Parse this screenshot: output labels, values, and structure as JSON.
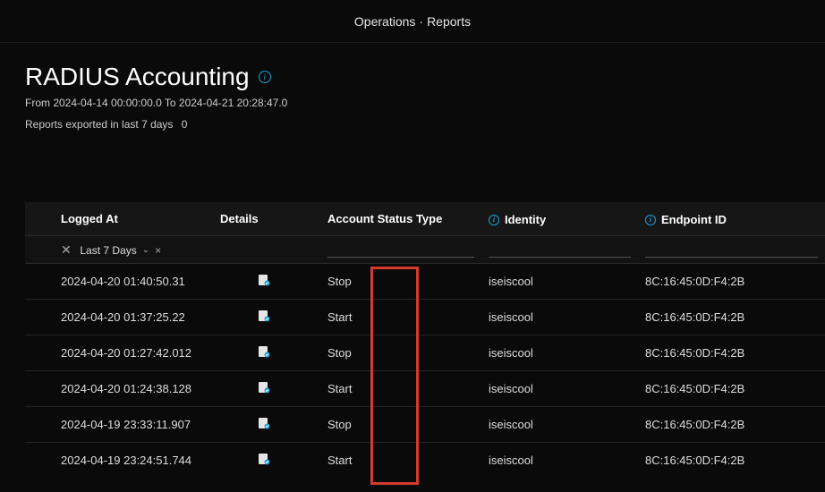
{
  "breadcrumb": {
    "part1": "Operations",
    "sep": "·",
    "part2": "Reports"
  },
  "page": {
    "title": "RADIUS Accounting",
    "date_range": "From 2024-04-14 00:00:00.0 To 2024-04-21 20:28:47.0",
    "exported_label": "Reports exported in last 7 days",
    "exported_count": "0"
  },
  "table": {
    "headers": {
      "logged_at": "Logged At",
      "details": "Details",
      "status": "Account Status Type",
      "identity": "Identity",
      "endpoint": "Endpoint ID"
    },
    "filter": {
      "range": "Last 7 Days"
    },
    "rows": [
      {
        "logged": "2024-04-20 01:40:50.31",
        "status": "Stop",
        "identity": "iseiscool",
        "endpoint": "8C:16:45:0D:F4:2B"
      },
      {
        "logged": "2024-04-20 01:37:25.22",
        "status": "Start",
        "identity": "iseiscool",
        "endpoint": "8C:16:45:0D:F4:2B"
      },
      {
        "logged": "2024-04-20 01:27:42.012",
        "status": "Stop",
        "identity": "iseiscool",
        "endpoint": "8C:16:45:0D:F4:2B"
      },
      {
        "logged": "2024-04-20 01:24:38.128",
        "status": "Start",
        "identity": "iseiscool",
        "endpoint": "8C:16:45:0D:F4:2B"
      },
      {
        "logged": "2024-04-19 23:33:11.907",
        "status": "Stop",
        "identity": "iseiscool",
        "endpoint": "8C:16:45:0D:F4:2B"
      },
      {
        "logged": "2024-04-19 23:24:51.744",
        "status": "Start",
        "identity": "iseiscool",
        "endpoint": "8C:16:45:0D:F4:2B"
      }
    ]
  }
}
